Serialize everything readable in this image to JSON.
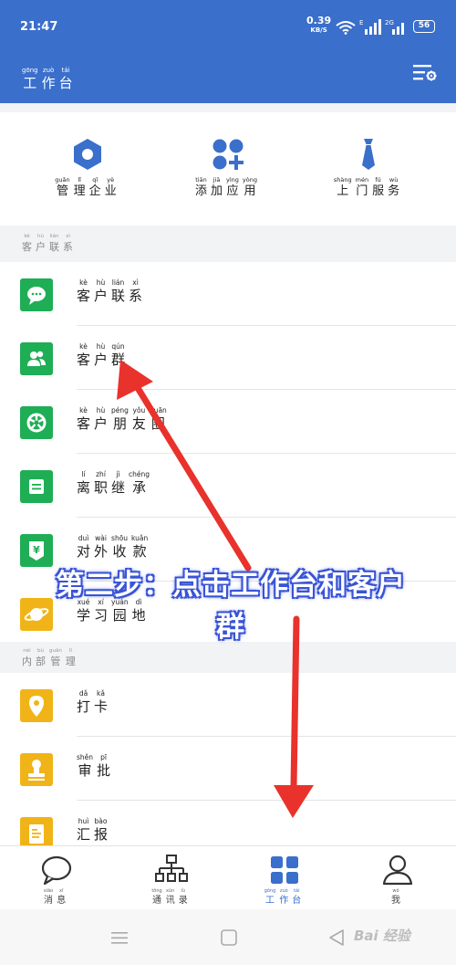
{
  "status_bar": {
    "time": "21:47",
    "speed": "0.39",
    "speed_unit": "KB/S",
    "network_1": "E",
    "network_2": "2G",
    "battery": "56"
  },
  "header": {
    "title": [
      {
        "py": "gōng",
        "hz": "工"
      },
      {
        "py": "zuò",
        "hz": "作"
      },
      {
        "py": "tái",
        "hz": "台"
      }
    ]
  },
  "quick_actions": [
    {
      "label": [
        {
          "py": "guǎn",
          "hz": "管"
        },
        {
          "py": "lǐ",
          "hz": "理"
        },
        {
          "py": "qǐ",
          "hz": "企"
        },
        {
          "py": "yè",
          "hz": "业"
        }
      ],
      "icon": "hexagon-icon",
      "color": "#3a6fcb"
    },
    {
      "label": [
        {
          "py": "tiān",
          "hz": "添"
        },
        {
          "py": "jiā",
          "hz": "加"
        },
        {
          "py": "yìng",
          "hz": "应"
        },
        {
          "py": "yòng",
          "hz": "用"
        }
      ],
      "icon": "add-app-icon",
      "color": "#3a6fcb"
    },
    {
      "label": [
        {
          "py": "shàng",
          "hz": "上"
        },
        {
          "py": "mén",
          "hz": "门"
        },
        {
          "py": "fú",
          "hz": "服"
        },
        {
          "py": "wù",
          "hz": "务"
        }
      ],
      "icon": "tie-icon",
      "color": "#3a6fcb"
    }
  ],
  "sections": {
    "customer": [
      {
        "py": "kè",
        "hz": "客"
      },
      {
        "py": "hù",
        "hz": "户"
      },
      {
        "py": "lián",
        "hz": "联"
      },
      {
        "py": "xì",
        "hz": "系"
      }
    ],
    "internal": [
      {
        "py": "nèi",
        "hz": "内"
      },
      {
        "py": "bù",
        "hz": "部"
      },
      {
        "py": "guǎn",
        "hz": "管"
      },
      {
        "py": "lǐ",
        "hz": "理"
      }
    ]
  },
  "customer_items": [
    {
      "label": [
        {
          "py": "kè",
          "hz": "客"
        },
        {
          "py": "hù",
          "hz": "户"
        },
        {
          "py": "lián",
          "hz": "联"
        },
        {
          "py": "xì",
          "hz": "系"
        }
      ],
      "icon": "chat-bubble-icon",
      "color": "#1fae55"
    },
    {
      "label": [
        {
          "py": "kè",
          "hz": "客"
        },
        {
          "py": "hù",
          "hz": "户"
        },
        {
          "py": "qún",
          "hz": "群"
        }
      ],
      "icon": "group-icon",
      "color": "#1fae55"
    },
    {
      "label": [
        {
          "py": "kè",
          "hz": "客"
        },
        {
          "py": "hù",
          "hz": "户"
        },
        {
          "py": "péng",
          "hz": "朋"
        },
        {
          "py": "yǒu",
          "hz": "友"
        },
        {
          "py": "quān",
          "hz": "圈"
        }
      ],
      "icon": "moments-icon",
      "color": "#1fae55"
    },
    {
      "label": [
        {
          "py": "lí",
          "hz": "离"
        },
        {
          "py": "zhí",
          "hz": "职"
        },
        {
          "py": "jì",
          "hz": "继"
        },
        {
          "py": "chéng",
          "hz": "承"
        }
      ],
      "icon": "transfer-icon",
      "color": "#1fae55"
    },
    {
      "label": [
        {
          "py": "duì",
          "hz": "对"
        },
        {
          "py": "wài",
          "hz": "外"
        },
        {
          "py": "shōu",
          "hz": "收"
        },
        {
          "py": "kuǎn",
          "hz": "款"
        }
      ],
      "icon": "payment-icon",
      "color": "#1fae55"
    },
    {
      "label": [
        {
          "py": "xué",
          "hz": "学"
        },
        {
          "py": "xí",
          "hz": "习"
        },
        {
          "py": "yuán",
          "hz": "园"
        },
        {
          "py": "dì",
          "hz": "地"
        }
      ],
      "icon": "planet-icon",
      "color": "#f0b418"
    }
  ],
  "internal_items": [
    {
      "label": [
        {
          "py": "dǎ",
          "hz": "打"
        },
        {
          "py": "kǎ",
          "hz": "卡"
        }
      ],
      "icon": "location-pin-icon",
      "color": "#f0b418"
    },
    {
      "label": [
        {
          "py": "shěn",
          "hz": "审"
        },
        {
          "py": "pī",
          "hz": "批"
        }
      ],
      "icon": "stamp-icon",
      "color": "#f0b418"
    },
    {
      "label": [
        {
          "py": "huì",
          "hz": "汇"
        },
        {
          "py": "bào",
          "hz": "报"
        }
      ],
      "icon": "report-icon",
      "color": "#f0b418"
    }
  ],
  "bottom_nav": [
    {
      "label": [
        {
          "py": "xiāo",
          "hz": "消"
        },
        {
          "py": "xī",
          "hz": "息"
        }
      ],
      "icon": "message-icon"
    },
    {
      "label": [
        {
          "py": "tōng",
          "hz": "通"
        },
        {
          "py": "xùn",
          "hz": "讯"
        },
        {
          "py": "lù",
          "hz": "录"
        }
      ],
      "icon": "contacts-tree-icon"
    },
    {
      "label": [
        {
          "py": "gōng",
          "hz": "工"
        },
        {
          "py": "zuò",
          "hz": "作"
        },
        {
          "py": "tái",
          "hz": "台"
        }
      ],
      "icon": "workbench-grid-icon",
      "active": true
    },
    {
      "label": [
        {
          "py": "wǒ",
          "hz": "我"
        }
      ],
      "icon": "profile-icon"
    }
  ],
  "annotation": {
    "line1": "第二步：点击工作台和客户",
    "line2": "群"
  },
  "watermark": "Bai 经验",
  "colors": {
    "brand": "#3a6fcb",
    "green": "#1fae55",
    "yellow": "#f0b418",
    "arrow": "#e8322b"
  }
}
